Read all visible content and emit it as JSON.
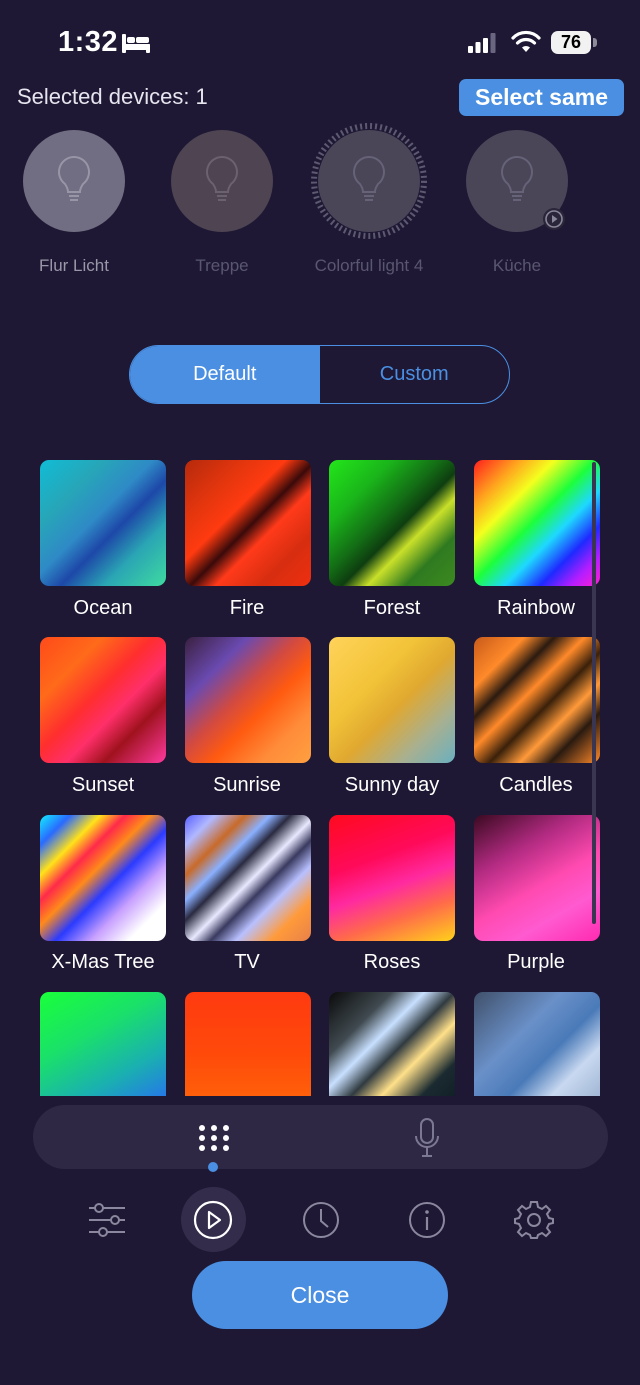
{
  "status_bar": {
    "time": "1:32",
    "battery": "76"
  },
  "header": {
    "selected_label": "Selected devices: 1",
    "select_same_label": "Select same"
  },
  "devices": [
    {
      "label": "Flur Licht"
    },
    {
      "label": "Treppe"
    },
    {
      "label": "Colorful light 4"
    },
    {
      "label": "Küche"
    }
  ],
  "segments": {
    "default_label": "Default",
    "custom_label": "Custom"
  },
  "effects": [
    {
      "label": "Ocean"
    },
    {
      "label": "Fire"
    },
    {
      "label": "Forest"
    },
    {
      "label": "Rainbow"
    },
    {
      "label": "Sunset"
    },
    {
      "label": "Sunrise"
    },
    {
      "label": "Sunny day"
    },
    {
      "label": "Candles"
    },
    {
      "label": "X-Mas Tree"
    },
    {
      "label": "TV"
    },
    {
      "label": "Roses"
    },
    {
      "label": "Purple"
    },
    {
      "label": ""
    },
    {
      "label": ""
    },
    {
      "label": ""
    },
    {
      "label": ""
    }
  ],
  "footer": {
    "close_label": "Close"
  },
  "colors": {
    "accent": "#4a8fe2",
    "background": "#1e1834",
    "dock": "#2e2845"
  }
}
